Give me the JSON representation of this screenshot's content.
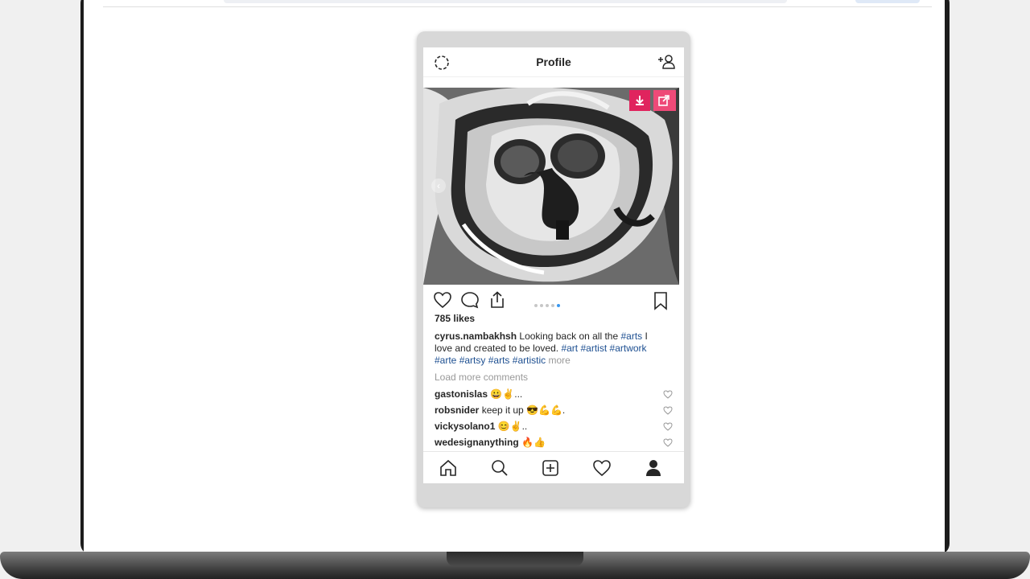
{
  "header": {
    "title": "Profile"
  },
  "post": {
    "likes": "785 likes",
    "caption": {
      "username": "cyrus.nambakhsh",
      "text_1": "Looking back on all the",
      "tag_1": "#arts",
      "text_2": "I love and created to be loved.",
      "tags": [
        "#art",
        "#artist",
        "#artwork",
        "#arte",
        "#artsy",
        "#arts",
        "#artistic"
      ],
      "more": "more"
    },
    "load_more_comments": "Load more comments",
    "comments": [
      {
        "user": "gastonislas",
        "text": "😀✌️..."
      },
      {
        "user": "robsnider",
        "text": "keep it up 😎💪💪."
      },
      {
        "user": "vickysolano1",
        "text": "😊✌️.."
      },
      {
        "user": "wedesignanything",
        "text": "🔥👍"
      }
    ],
    "carousel": {
      "count": 5,
      "active_index": 4
    }
  },
  "icons": {
    "top_left": "settings-icon",
    "top_right": "add-user-icon",
    "download": "download-icon",
    "open_external": "external-link-icon",
    "bottom_nav": [
      "home-icon",
      "search-icon",
      "add-icon",
      "heart-icon",
      "profile-icon"
    ]
  },
  "colors": {
    "accent": "#e0245e",
    "hashtag": "#1d4f91",
    "active_dot": "#3897f0"
  }
}
